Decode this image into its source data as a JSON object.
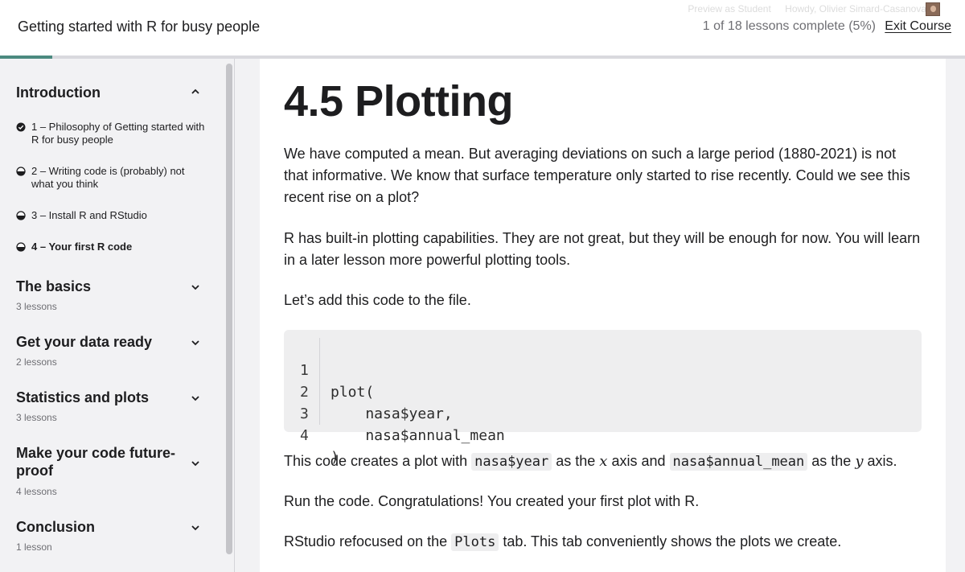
{
  "header": {
    "course_title": "Getting started with R for busy people",
    "admin": {
      "preview": "Preview as Student",
      "howdy": "Howdy, Olivier Simard-Casanova"
    },
    "progress_text": "1 of 18 lessons complete (5%)",
    "progress_fraction": 0.054,
    "exit_label": "Exit Course",
    "accent_color": "#4b8a7f"
  },
  "sidebar": {
    "sections": [
      {
        "title": "Introduction",
        "expanded": true,
        "lessons": [
          {
            "label": "1 – Philosophy of Getting started with R for busy people",
            "status": "complete"
          },
          {
            "label": "2 – Writing code is (probably) not what you think",
            "status": "in-progress"
          },
          {
            "label": "3 – Install R and RStudio",
            "status": "in-progress"
          },
          {
            "label": "4 – Your first R code",
            "status": "in-progress",
            "current": true
          }
        ]
      },
      {
        "title": "The basics",
        "count": "3 lessons",
        "expanded": false
      },
      {
        "title": "Get your data ready",
        "count": "2 lessons",
        "expanded": false
      },
      {
        "title": "Statistics and plots",
        "count": "3 lessons",
        "expanded": false
      },
      {
        "title": "Make your code future-proof",
        "count": "4 lessons",
        "expanded": false
      },
      {
        "title": "Conclusion",
        "count": "1 lesson",
        "expanded": false
      }
    ]
  },
  "main": {
    "title": "4.5 Plotting",
    "p1": "We have computed a mean. But averaging deviations on such a large period (1880-2021) is not that informative. We know that surface temperature only started to rise recently. Could we see this recent rise on a plot?",
    "p2": "R has built-in plotting capabilities. They are not great, but they will be enough for now. You will learn in a later lesson more powerful plotting tools.",
    "p3": "Let’s add this code to the file.",
    "code": [
      {
        "n": "1",
        "text": "plot("
      },
      {
        "n": "2",
        "text": "    nasa$year,"
      },
      {
        "n": "3",
        "text": "    nasa$annual_mean"
      },
      {
        "n": "4",
        "text": ")"
      }
    ],
    "p4": {
      "a": "This code creates a plot with ",
      "code1": "nasa$year",
      "b": " as the ",
      "x": "x",
      "c": " axis and ",
      "code2": "nasa$annual_mean",
      "d": " as the ",
      "y": "y",
      "e": " axis."
    },
    "p5": "Run the code. Congratulations! You created your first plot with R.",
    "p6": {
      "a": "RStudio refocused on the ",
      "code": "Plots",
      "b": " tab. This tab conveniently shows the plots we create."
    }
  }
}
